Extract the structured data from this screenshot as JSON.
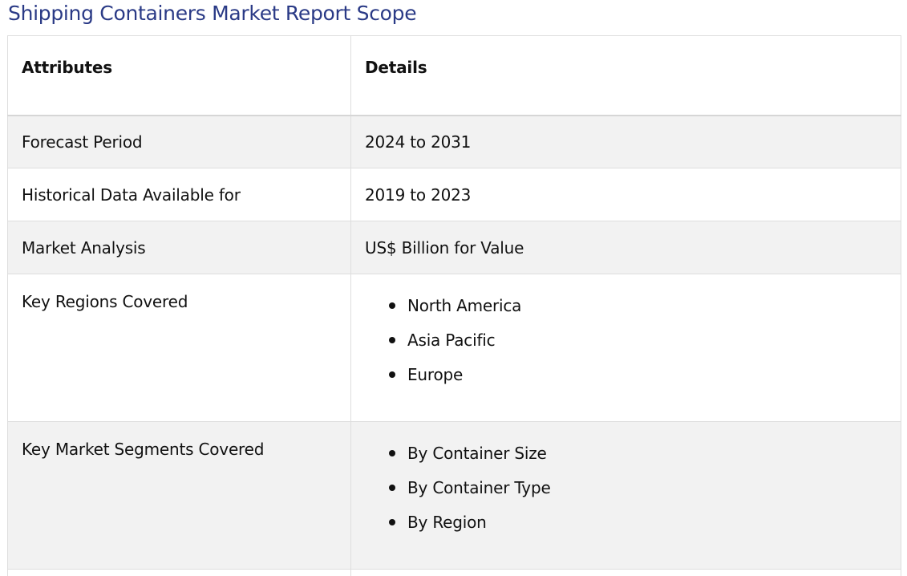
{
  "title": "Shipping Containers Market Report Scope",
  "table": {
    "headers": [
      "Attributes",
      "Details"
    ],
    "rows": [
      {
        "attribute": "Forecast Period",
        "detail": "2024 to 2031"
      },
      {
        "attribute": "Historical Data Available for",
        "detail": "2019 to 2023"
      },
      {
        "attribute": "Market Analysis",
        "detail": "US$ Billion for Value"
      },
      {
        "attribute": "Key Regions Covered",
        "items": [
          "North America",
          "Asia Pacific",
          "Europe"
        ]
      },
      {
        "attribute": "Key Market Segments Covered",
        "items": [
          "By Container Size",
          "By Container Type",
          "By Region"
        ]
      }
    ]
  },
  "colors": {
    "title": "#2a3a86",
    "row_shade": "#f2f2f2",
    "border": "#dedede"
  }
}
